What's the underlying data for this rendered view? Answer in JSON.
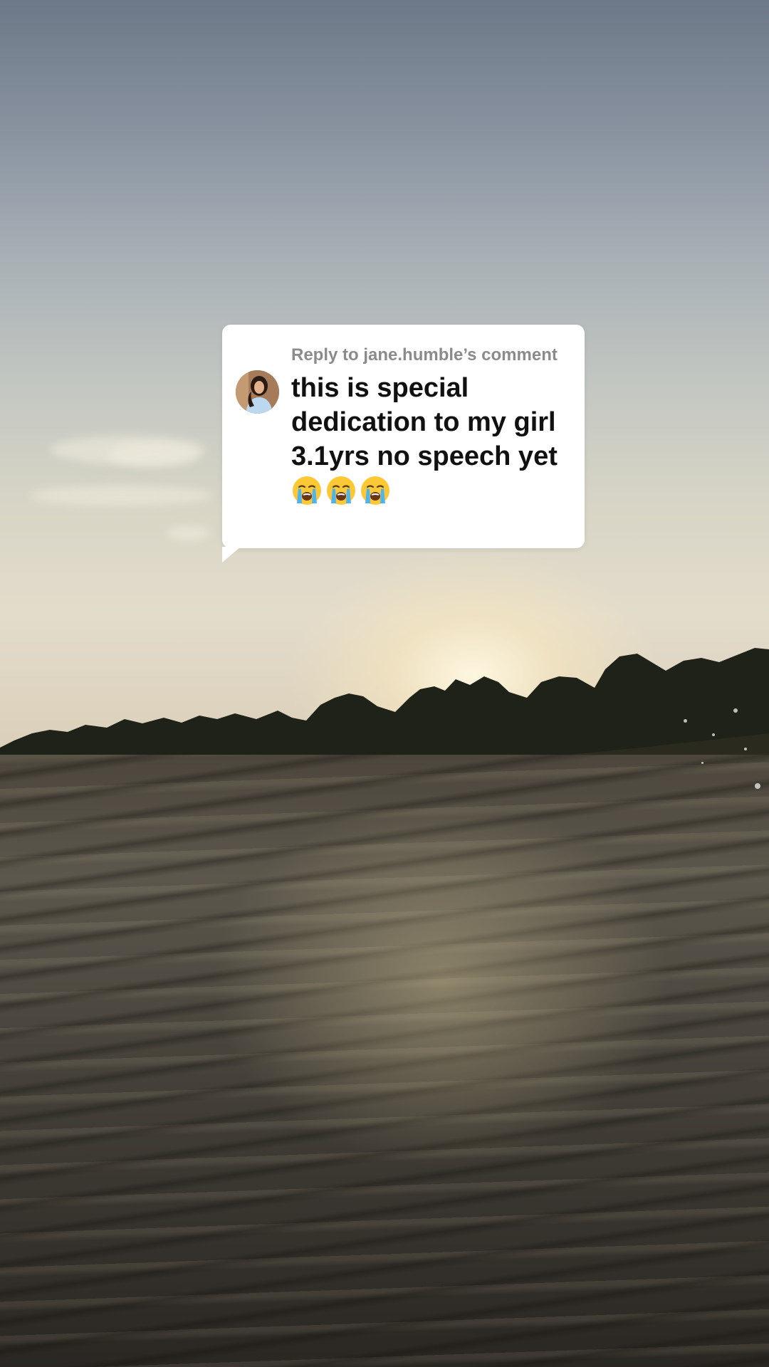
{
  "reply_sticker": {
    "header": "Reply to jane.humble’s comment",
    "comment_text": "this is special dedication to my girl 3.1yrs no speech yet",
    "emojis": [
      "loudly-crying-face-icon",
      "loudly-crying-face-icon",
      "loudly-crying-face-icon"
    ],
    "background_color": "#ffffff",
    "header_color": "#8b8b8b",
    "text_color": "#111111"
  },
  "background": {
    "scene": "sunset-over-river"
  }
}
